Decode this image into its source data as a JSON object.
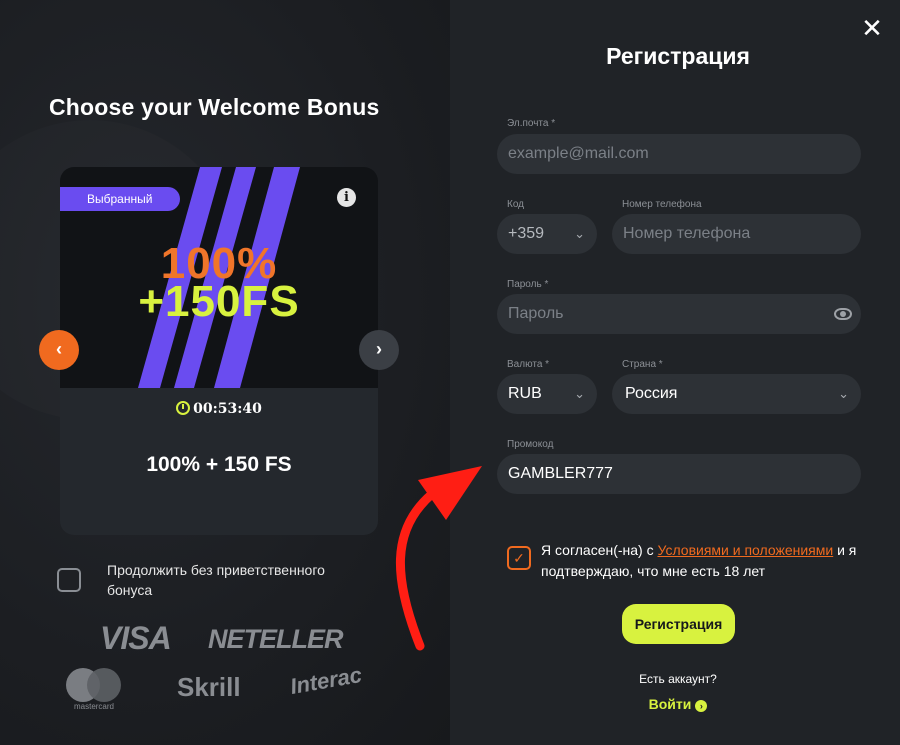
{
  "left": {
    "title": "Choose your Welcome Bonus",
    "card": {
      "badge": "Выбранный",
      "info": "i",
      "promo_line1": "100%",
      "promo_line2": "+150FS",
      "timer": "00:53:40",
      "offer": "100% + 150 FS"
    },
    "prev_arrow": "‹",
    "next_arrow": "›",
    "continue_without_bonus": "Продолжить без приветственного бонуса",
    "payment_logos": {
      "visa": "VISA",
      "neteller": "NETELLER",
      "mastercard": "mastercard",
      "skrill": "Skrill",
      "interac": "Interac"
    }
  },
  "form": {
    "close": "✕",
    "title": "Регистрация",
    "email_label": "Эл.почта *",
    "email_placeholder": "example@mail.com",
    "code_label": "Код",
    "code_value": "+359",
    "phone_label": "Номер телефона",
    "phone_placeholder": "Номер телефона",
    "password_label": "Пароль *",
    "password_placeholder": "Пароль",
    "currency_label": "Валюта *",
    "currency_value": "RUB",
    "country_label": "Страна *",
    "country_value": "Россия",
    "promo_label": "Промокод",
    "promo_value": "GAMBLER777",
    "agree_prefix": "Я согласен(-на) с ",
    "agree_link": "Условиями и положениями",
    "agree_suffix": " и я подтверждаю, что мне есть 18 лет",
    "submit": "Регистрация",
    "have_account": "Есть аккаунт?",
    "login": "Войти"
  },
  "colors": {
    "accent_orange": "#f06a1f",
    "accent_lime": "#d8f23f",
    "badge_purple": "#6a4cf0",
    "annotation_red": "#ff1e14"
  }
}
